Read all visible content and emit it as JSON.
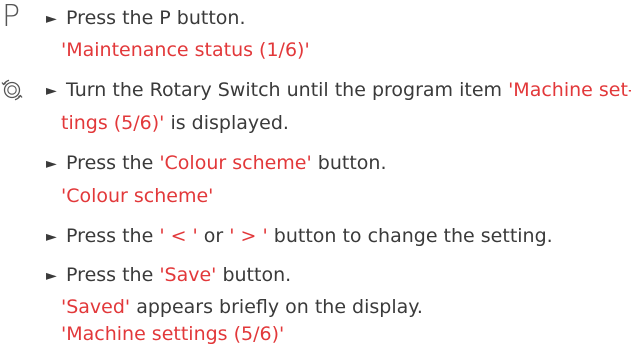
{
  "icons": {
    "p_button_glyph": "P",
    "rotary_switch": "rotary-switch-icon"
  },
  "bullet": "►",
  "colors": {
    "text": "#3a3a3a",
    "highlight": "#e2383a"
  },
  "steps": [
    {
      "instruction": "Press the P button."
    },
    {
      "display": "'Maintenance status (1/6)'"
    },
    {
      "instruction_prefix": "Turn the Rotary Switch until the program item ",
      "instruction_highlight": "'Machine set-",
      "continuation_highlight": "tings (5/6)'",
      "continuation_suffix": " is displayed."
    },
    {
      "instruction_prefix": "Press the ",
      "instruction_highlight": "'Colour scheme'",
      "instruction_suffix": " button."
    },
    {
      "display": "'Colour scheme'"
    },
    {
      "instruction_prefix": "Press the ",
      "highlight_1": "' < '",
      "middle": " or ",
      "highlight_2": "' > '",
      "instruction_suffix": " button to change the setting."
    },
    {
      "instruction_prefix": "Press the ",
      "instruction_highlight": "'Save'",
      "instruction_suffix": " button."
    },
    {
      "display_highlight": "'Saved'",
      "display_suffix": " appears briefly on the display."
    },
    {
      "display": "'Machine settings (5/6)'"
    }
  ]
}
